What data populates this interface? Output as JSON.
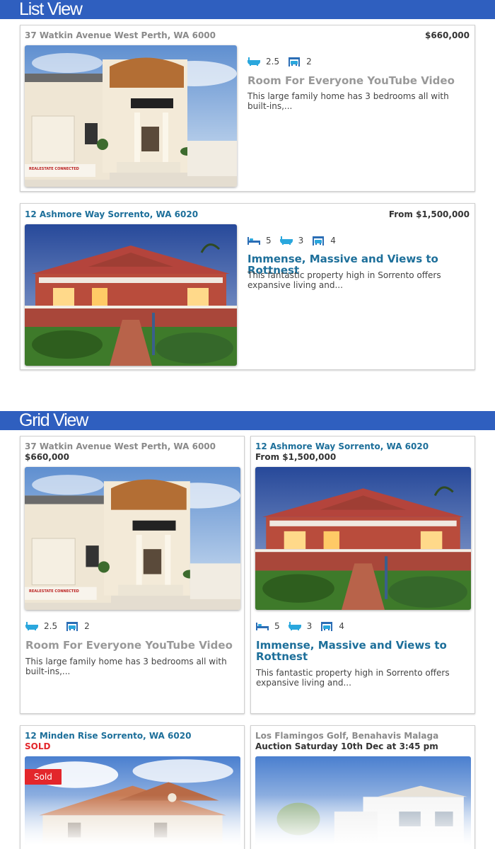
{
  "list_view": {
    "heading": "List View",
    "listings": [
      {
        "address": "37 Watkin Avenue West Perth, WA 6000",
        "price": "$660,000",
        "baths": "2.5",
        "garages": "2",
        "title": "Room For Everyone YouTube Video",
        "excerpt": "This large family home has 3 bedrooms all with built-ins,...",
        "watermark": "REALESTATE CONNECTED"
      },
      {
        "address": "12 Ashmore Way Sorrento, WA 6020",
        "price": "From $1,500,000",
        "beds": "5",
        "baths": "3",
        "garages": "4",
        "title": "Immense, Massive and Views to Rottnest",
        "excerpt": "This fantastic property high in Sorrento offers expansive living and..."
      }
    ]
  },
  "grid_view": {
    "heading": "Grid View",
    "listings": [
      {
        "address": "37 Watkin Avenue West Perth, WA 6000",
        "price": "$660,000",
        "baths": "2.5",
        "garages": "2",
        "title": "Room For Everyone YouTube Video",
        "excerpt": "This large family home has 3 bedrooms all with built-ins,...",
        "watermark": "REALESTATE CONNECTED"
      },
      {
        "address": "12 Ashmore Way Sorrento, WA 6020",
        "price": "From $1,500,000",
        "beds": "5",
        "baths": "3",
        "garages": "4",
        "title": "Immense, Massive and Views to Rottnest",
        "excerpt": "This fantastic property high in Sorrento offers expansive living and..."
      },
      {
        "address": "12 Minden Rise Sorrento, WA 6020",
        "price": "SOLD",
        "badge": "Sold"
      },
      {
        "address": "Los Flamingos Golf, Benahavis Malaga",
        "price": "Auction Saturday 10th Dec at 3:45 pm"
      }
    ]
  },
  "icons": {
    "beds": "bed-icon",
    "baths": "bath-icon",
    "garages": "garage-icon"
  },
  "colors": {
    "header_bar": "#2f5fbf",
    "link_blue": "#1d6f9a",
    "feature_icon": "#2aa7dd",
    "sold_red": "#e3262b",
    "muted_title": "#999999"
  }
}
